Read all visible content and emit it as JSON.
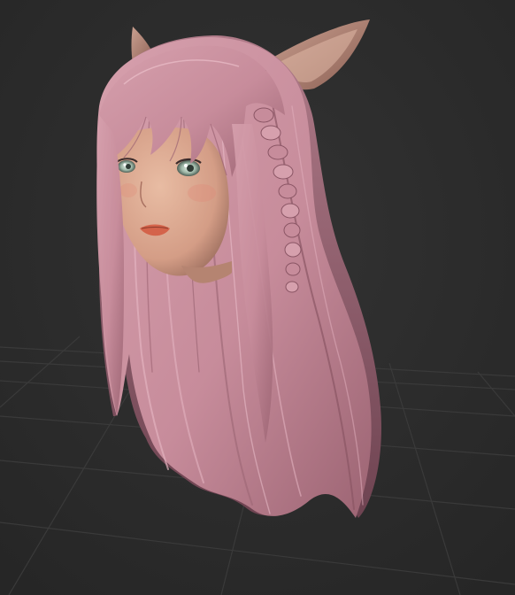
{
  "viewport": {
    "background_color": "#2b2b2b",
    "grid_color": "#3a3a3a",
    "grid_visible": true
  },
  "model": {
    "hair_color": "#c78c9b",
    "hair_shadow_color": "#7a4d5a",
    "skin_color": "#d9a48c",
    "ear_color": "#b9877a",
    "eye_color": "#9fb8a8",
    "lip_color": "#d4634a"
  }
}
